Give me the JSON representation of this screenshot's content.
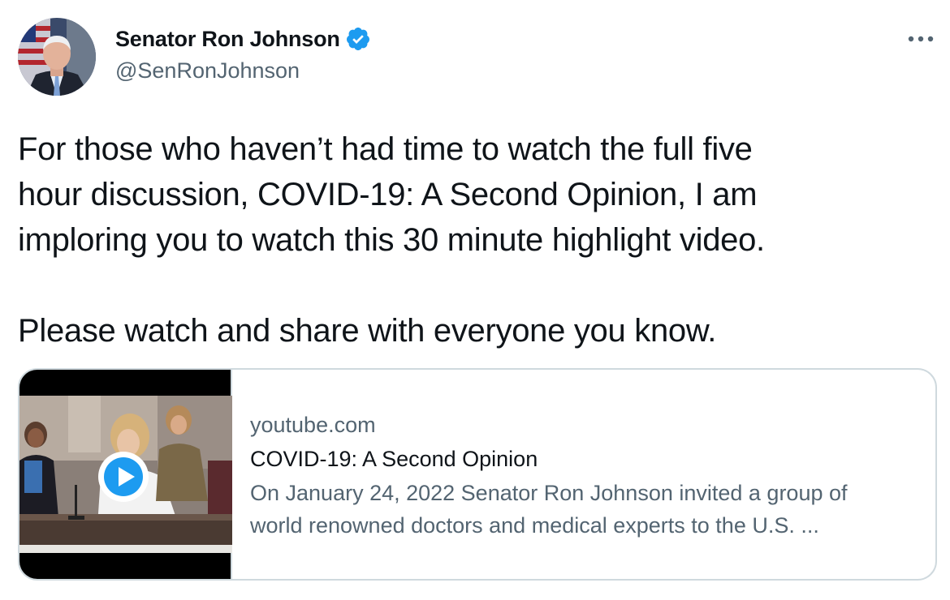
{
  "author": {
    "display_name": "Senator Ron Johnson",
    "handle": "@SenRonJohnson",
    "verified": true,
    "avatar_icon": "avatar-photo"
  },
  "more_icon": "more-horizontal-icon",
  "tweet": {
    "lines": [
      "For those who haven’t had time to watch the full five",
      "hour discussion, COVID-19: A Second Opinion, I am",
      "imploring you to watch this 30 minute highlight video.",
      "Please watch and share with everyone you know."
    ]
  },
  "card": {
    "domain": "youtube.com",
    "title": "COVID-19: A Second Opinion",
    "description_lines": [
      "On January 24, 2022 Senator Ron Johnson invited a group of",
      "world renowned doctors and medical experts to the U.S. ..."
    ],
    "thumbnail_icon": "video-thumbnail",
    "play_icon": "play-icon"
  },
  "colors": {
    "text_primary": "#0f1419",
    "text_secondary": "#536471",
    "verified_blue": "#1d9bf0",
    "card_border": "#cfd9de"
  }
}
